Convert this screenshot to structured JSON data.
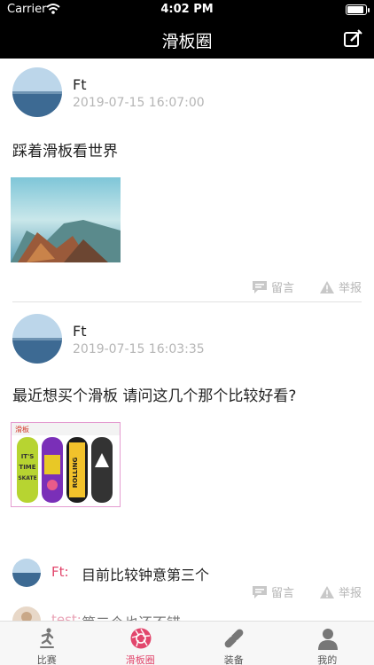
{
  "status_bar": {
    "carrier": "Carrier",
    "time": "4:02 PM",
    "battery_level": 0.9
  },
  "nav": {
    "title": "滑板圈",
    "edit_icon": "edit-icon"
  },
  "posts": [
    {
      "username": "Ft",
      "date": "2019-07-15 16:07:00",
      "text": "踩着滑板看世界",
      "comment_label": "留言",
      "report_label": "举报"
    },
    {
      "username": "Ft",
      "date": "2019-07-15 16:03:35",
      "text": "最近想买个滑板 请问这几个那个比较好看?",
      "comment_label": "留言",
      "report_label": "举报",
      "image_text": {
        "banner_left": "滑板",
        "board1_line1": "IT'S",
        "board1_line2": "TIME",
        "board1_line3": "SKATE",
        "board3": "ROLLING"
      }
    }
  ],
  "comments": [
    {
      "name": "Ft:",
      "text": "目前比较钟意第三个"
    },
    {
      "name": "test:",
      "text": "第二个也还不错"
    }
  ],
  "tabs": [
    {
      "label": "比赛",
      "icon": "skater-icon",
      "active": false
    },
    {
      "label": "滑板圈",
      "icon": "aperture-icon",
      "active": true
    },
    {
      "label": "装备",
      "icon": "skateboard-icon",
      "active": false
    },
    {
      "label": "我的",
      "icon": "person-icon",
      "active": false
    }
  ],
  "colors": {
    "accent": "#e2466c",
    "bar": "#000000",
    "muted": "#b5b5b5"
  }
}
